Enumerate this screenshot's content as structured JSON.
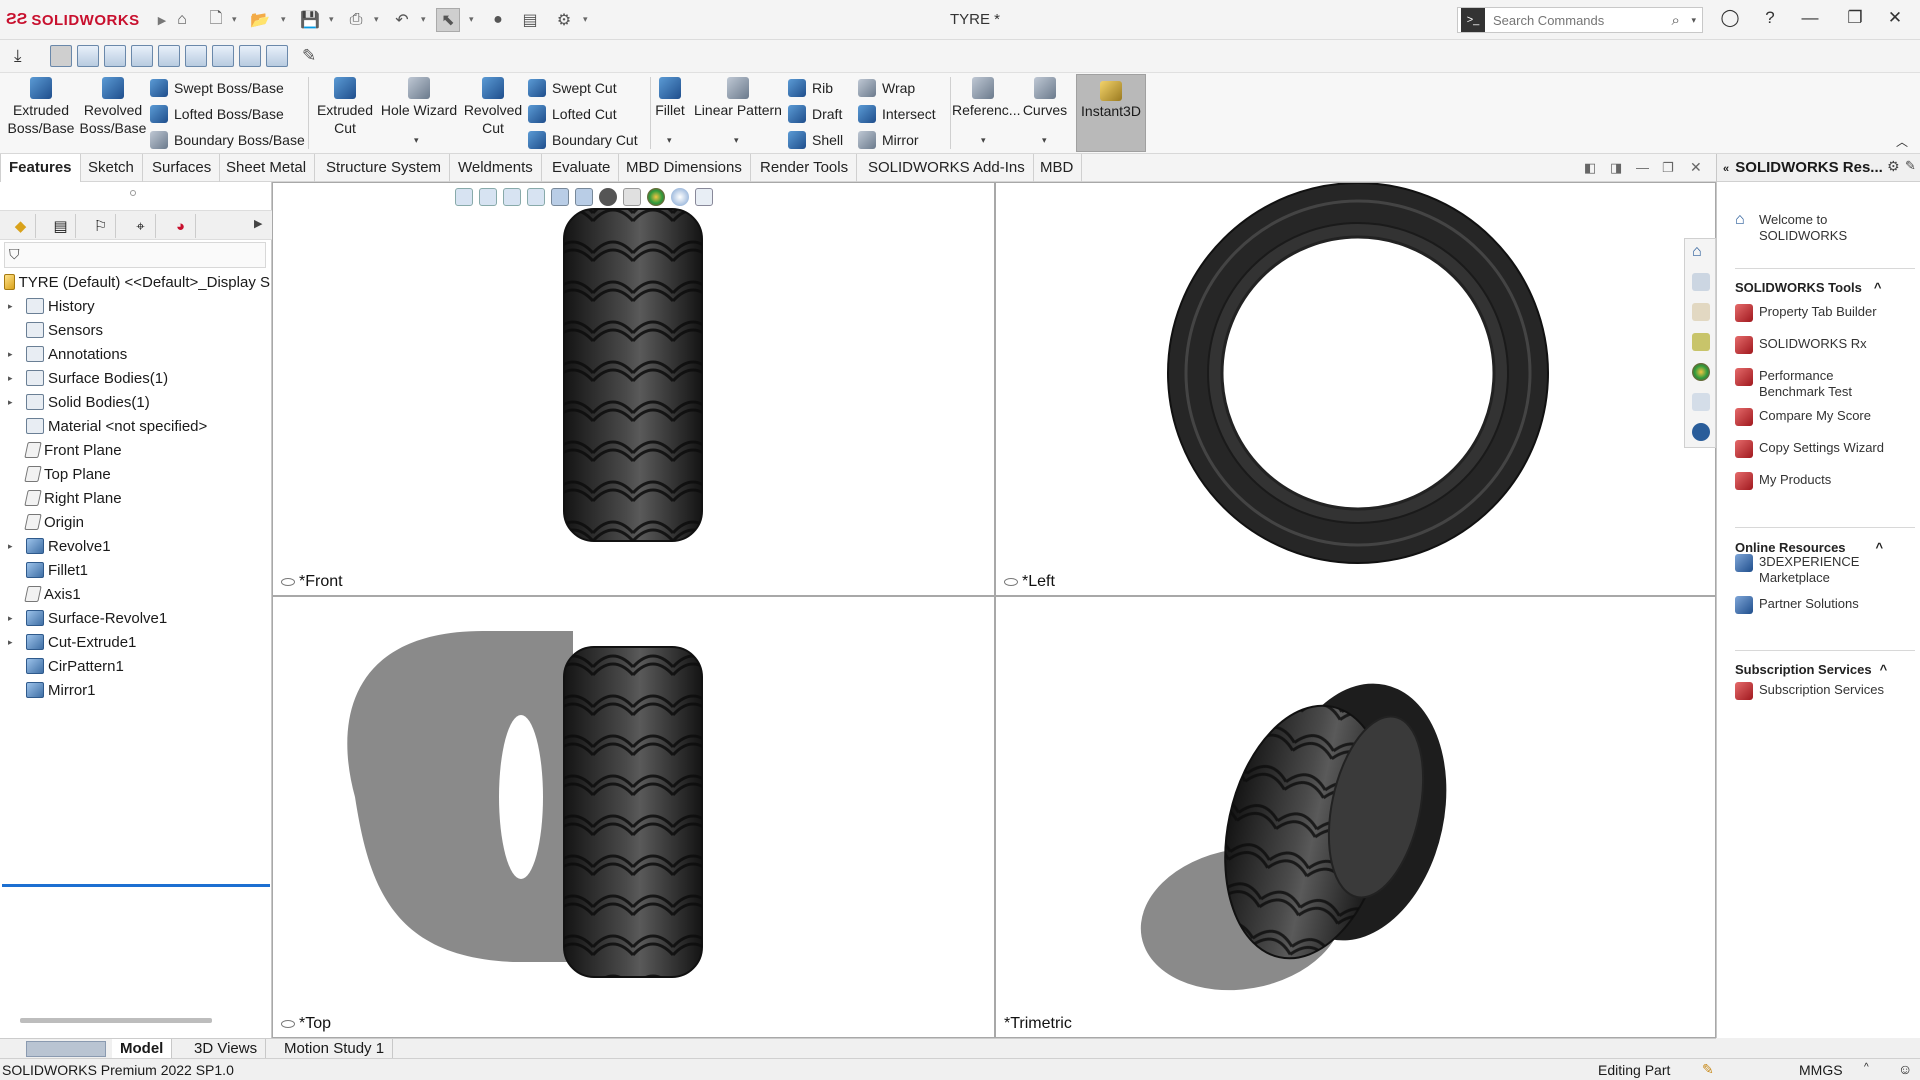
{
  "app": {
    "brand": "SOLIDWORKS",
    "document_title": "TYRE *"
  },
  "search": {
    "placeholder": "Search Commands"
  },
  "commands": {
    "extruded_boss": "Extruded\nBoss/Base",
    "revolved_boss": "Revolved\nBoss/Base",
    "swept_boss": "Swept Boss/Base",
    "lofted_boss": "Lofted Boss/Base",
    "boundary_boss": "Boundary Boss/Base",
    "extruded_cut": "Extruded\nCut",
    "hole_wizard": "Hole Wizard",
    "revolved_cut": "Revolved\nCut",
    "swept_cut": "Swept Cut",
    "lofted_cut": "Lofted Cut",
    "boundary_cut": "Boundary Cut",
    "fillet": "Fillet",
    "linear_pattern": "Linear Pattern",
    "rib": "Rib",
    "draft": "Draft",
    "shell": "Shell",
    "wrap": "Wrap",
    "intersect": "Intersect",
    "mirror": "Mirror",
    "reference": "Referenc...",
    "curves": "Curves",
    "instant3d": "Instant3D"
  },
  "tabs": [
    "Features",
    "Sketch",
    "Surfaces",
    "Sheet Metal",
    "Structure System",
    "Weldments",
    "Evaluate",
    "MBD Dimensions",
    "Render Tools",
    "SOLIDWORKS Add-Ins",
    "MBD"
  ],
  "tree": {
    "root": "TYRE (Default) <<Default>_Display S",
    "items": [
      {
        "label": "History",
        "expand": true,
        "icon": "folder"
      },
      {
        "label": "Sensors",
        "expand": false,
        "icon": "folder"
      },
      {
        "label": "Annotations",
        "expand": true,
        "icon": "folder"
      },
      {
        "label": "Surface Bodies(1)",
        "expand": true,
        "icon": "folder"
      },
      {
        "label": "Solid Bodies(1)",
        "expand": true,
        "icon": "folder"
      },
      {
        "label": "Material <not specified>",
        "expand": false,
        "icon": "folder"
      },
      {
        "label": "Front Plane",
        "expand": false,
        "icon": "plane"
      },
      {
        "label": "Top Plane",
        "expand": false,
        "icon": "plane"
      },
      {
        "label": "Right Plane",
        "expand": false,
        "icon": "plane"
      },
      {
        "label": "Origin",
        "expand": false,
        "icon": "plane"
      },
      {
        "label": "Revolve1",
        "expand": true,
        "icon": "feat"
      },
      {
        "label": "Fillet1",
        "expand": false,
        "icon": "feat"
      },
      {
        "label": "Axis1",
        "expand": false,
        "icon": "plane"
      },
      {
        "label": "Surface-Revolve1",
        "expand": true,
        "icon": "feat"
      },
      {
        "label": "Cut-Extrude1",
        "expand": true,
        "icon": "feat"
      },
      {
        "label": "CirPattern1",
        "expand": false,
        "icon": "feat"
      },
      {
        "label": "Mirror1",
        "expand": false,
        "icon": "feat"
      }
    ]
  },
  "viewports": {
    "front": "*Front",
    "left": "*Left",
    "top": "*Top",
    "trimetric": "*Trimetric"
  },
  "taskpane": {
    "title": "SOLIDWORKS Res...",
    "welcome": "Welcome to\nSOLIDWORKS",
    "tools_header": "SOLIDWORKS Tools",
    "tools": [
      "Property Tab Builder",
      "SOLIDWORKS Rx",
      "Performance\nBenchmark Test",
      "Compare My Score",
      "Copy Settings Wizard",
      "My Products"
    ],
    "online_header": "Online Resources",
    "online": [
      "3DEXPERIENCE\nMarketplace",
      "Partner Solutions"
    ],
    "subs_header": "Subscription Services",
    "subs": [
      "Subscription Services"
    ]
  },
  "bottom_tabs": [
    "Model",
    "3D Views",
    "Motion Study 1"
  ],
  "status": {
    "version": "SOLIDWORKS Premium 2022 SP1.0",
    "mode": "Editing Part",
    "units": "MMGS"
  },
  "colors": {
    "brand_red": "#c8102e",
    "accent_blue": "#1c6fd1",
    "tyre": "#2a2a2a"
  }
}
